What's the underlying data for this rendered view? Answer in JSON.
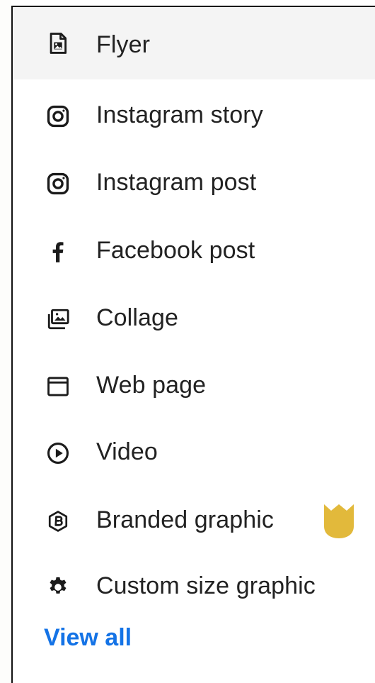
{
  "menu": {
    "items": [
      {
        "label": "Flyer",
        "icon": "flyer-icon",
        "active": true
      },
      {
        "label": "Instagram story",
        "icon": "instagram-icon"
      },
      {
        "label": "Instagram post",
        "icon": "instagram-icon"
      },
      {
        "label": "Facebook post",
        "icon": "facebook-icon"
      },
      {
        "label": "Collage",
        "icon": "collage-icon"
      },
      {
        "label": "Web page",
        "icon": "web-page-icon"
      },
      {
        "label": "Video",
        "icon": "video-play-icon"
      },
      {
        "label": "Branded graphic",
        "icon": "branded-graphic-icon",
        "badge": "premium-crown-icon"
      },
      {
        "label": "Custom size graphic",
        "icon": "gear-icon"
      }
    ],
    "view_all_label": "View all"
  },
  "colors": {
    "link": "#1473e6",
    "badge": "#e2b93b",
    "active_row": "#f4f4f4",
    "text": "#222222"
  }
}
